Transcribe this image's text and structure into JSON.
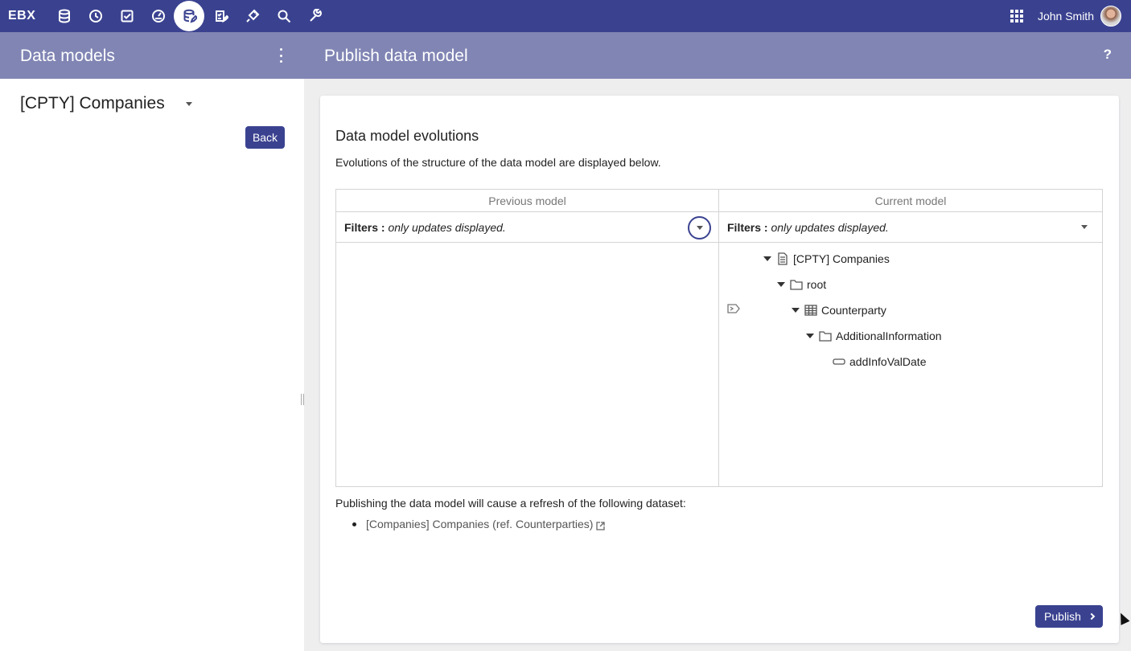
{
  "topbar": {
    "brand": "EBX",
    "icons": [
      "database-icon",
      "history-icon",
      "tasks-icon",
      "dashboard-icon",
      "data-model-icon",
      "workflow-icon",
      "plugin-icon",
      "search-icon",
      "admin-wrench-icon"
    ],
    "active_icon": "data-model-icon",
    "user_name": "John Smith"
  },
  "subheader": {
    "left_title": "Data models",
    "right_title": "Publish data model",
    "help": "?"
  },
  "sidebar": {
    "selected_model": "[CPTY] Companies",
    "back_label": "Back"
  },
  "main": {
    "title": "Data model evolutions",
    "description": "Evolutions of the structure of the data model are displayed below.",
    "previous_header": "Previous model",
    "current_header": "Current model",
    "filters_label": "Filters :",
    "filters_value": "only updates displayed.",
    "tree": [
      {
        "label": "[CPTY] Companies",
        "icon": "document-icon"
      },
      {
        "label": "root",
        "icon": "folder-icon"
      },
      {
        "label": "Counterparty",
        "icon": "table-icon"
      },
      {
        "label": "AdditionalInformation",
        "icon": "folder-icon"
      },
      {
        "label": "addInfoValDate",
        "icon": "field-icon"
      }
    ],
    "refresh_text": "Publishing the data model will cause a refresh of the following dataset:",
    "dataset": "[Companies] Companies (ref. Counterparties)",
    "publish_label": "Publish"
  }
}
